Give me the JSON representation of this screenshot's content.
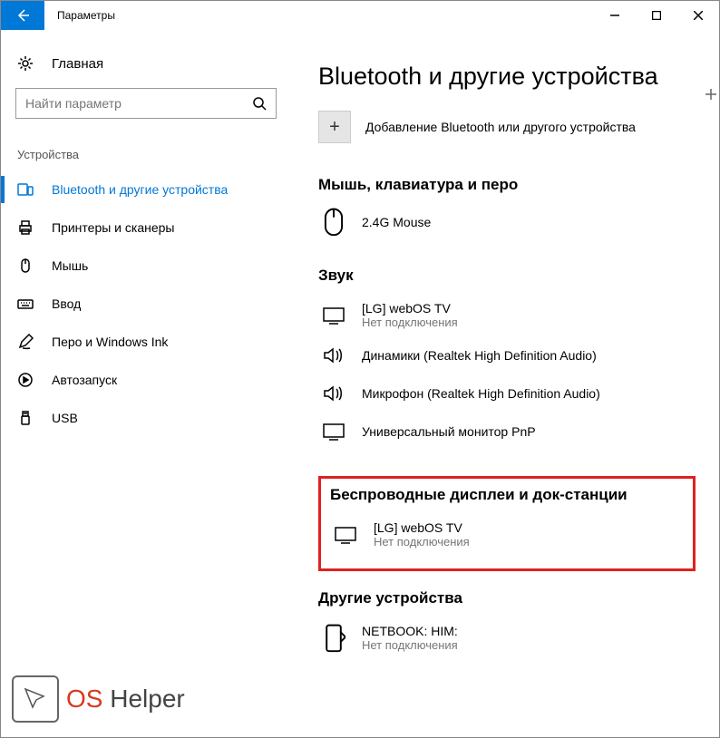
{
  "titlebar": {
    "title": "Параметры"
  },
  "sidebar": {
    "home": "Главная",
    "search_placeholder": "Найти параметр",
    "category": "Устройства",
    "items": [
      {
        "label": "Bluetooth и другие устройства"
      },
      {
        "label": "Принтеры и сканеры"
      },
      {
        "label": "Мышь"
      },
      {
        "label": "Ввод"
      },
      {
        "label": "Перо и Windows Ink"
      },
      {
        "label": "Автозапуск"
      },
      {
        "label": "USB"
      }
    ]
  },
  "main": {
    "heading": "Bluetooth и другие устройства",
    "add_label": "Добавление Bluetooth или другого устройства",
    "sections": {
      "input": {
        "title": "Мышь, клавиатура и перо",
        "dev0": {
          "name": "2.4G Mouse"
        }
      },
      "audio": {
        "title": "Звук",
        "dev0": {
          "name": "[LG] webOS TV",
          "status": "Нет подключения"
        },
        "dev1": {
          "name": "Динамики (Realtek High Definition Audio)"
        },
        "dev2": {
          "name": "Микрофон (Realtek High Definition Audio)"
        },
        "dev3": {
          "name": "Универсальный монитор PnP"
        }
      },
      "wireless": {
        "title": "Беспроводные дисплеи и док-станции",
        "dev0": {
          "name": "[LG] webOS TV",
          "status": "Нет подключения"
        }
      },
      "other": {
        "title": "Другие устройства",
        "dev0": {
          "name": "NETBOOK: HIM:",
          "status": "Нет подключения"
        }
      }
    }
  },
  "watermark": {
    "part1": "OS",
    "part2": " Helper"
  }
}
